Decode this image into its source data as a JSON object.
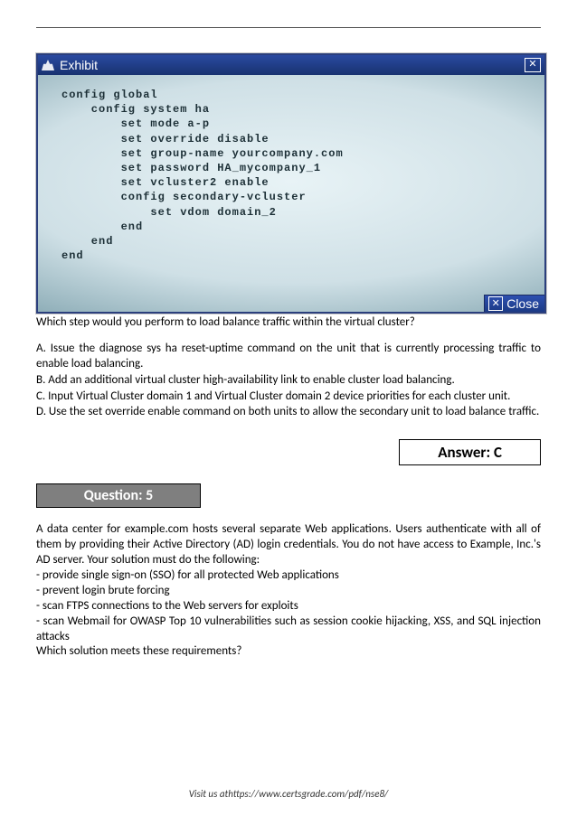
{
  "exhibit": {
    "title": "Exhibit",
    "close_label": "Close",
    "code": "config global\n    config system ha\n        set mode a-p\n        set override disable\n        set group-name yourcompany.com\n        set password HA_mycompany_1\n        set vcluster2 enable\n        config secondary-vcluster\n            set vdom domain_2\n        end\n    end\nend"
  },
  "q4": {
    "question": "Which step would you perform to load balance traffic within the virtual cluster?",
    "opt_a": "A. Issue the diagnose sys ha reset-uptime command on the unit that is currently processing traffic to enable load balancing.",
    "opt_b": "B. Add an additional virtual cluster high-availability link to enable cluster load balancing.",
    "opt_c": "C. Input Virtual Cluster domain 1 and Virtual Cluster domain 2 device priorities for each cluster unit.",
    "opt_d": "D. Use the set override enable command on both units to allow the secondary unit to load balance traffic.",
    "answer": "Answer: C"
  },
  "q5": {
    "tag": "Question: 5",
    "intro": "A data center for example.com hosts several separate Web applications. Users authenticate with all of them by providing their Active Directory (AD) login credentials. You do not have access to Example, Inc.'s AD server. Your solution must do the following:",
    "b1": "- provide single sign-on (SSO) for all protected Web applications",
    "b2": "- prevent login brute forcing",
    "b3": "- scan FTPS connections to the Web servers for exploits",
    "b4": "- scan Webmail for OWASP Top 10 vulnerabilities such as session cookie hijacking, XSS, and SQL injection attacks",
    "final": "Which solution meets these requirements?"
  },
  "footer": "Visit us athttps://www.certsgrade.com/pdf/nse8/"
}
